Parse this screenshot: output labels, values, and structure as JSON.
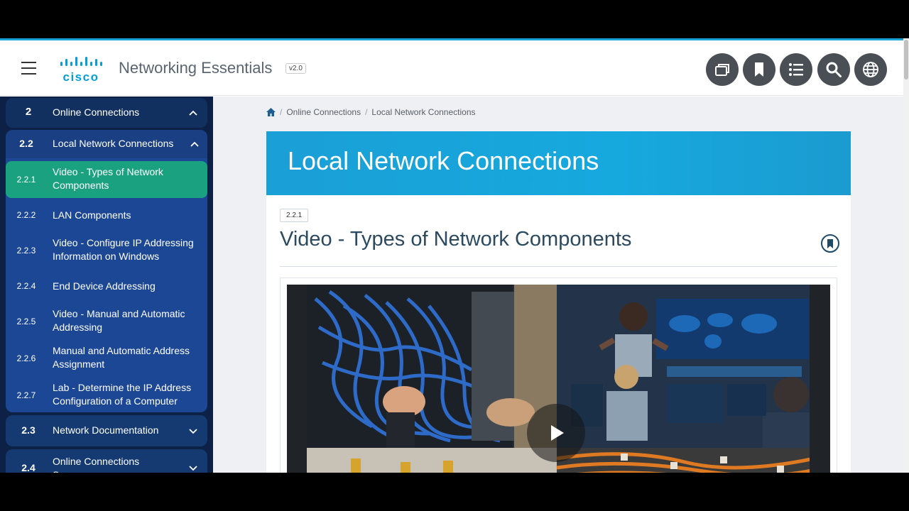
{
  "header": {
    "logo_text": "cisco",
    "title": "Networking Essentials",
    "version": "v2.0",
    "buttons": [
      {
        "icon": "window-icon"
      },
      {
        "icon": "bookmark-icon"
      },
      {
        "icon": "list-icon"
      },
      {
        "icon": "search-icon"
      },
      {
        "icon": "globe-icon"
      }
    ]
  },
  "sidebar": {
    "module": {
      "num": "2",
      "label": "Online Connections"
    },
    "section": {
      "num": "2.2",
      "label": "Local Network Connections"
    },
    "items": [
      {
        "num": "2.2.1",
        "label": "Video - Types of Network Components"
      },
      {
        "num": "2.2.2",
        "label": "LAN Components"
      },
      {
        "num": "2.2.3",
        "label": "Video - Configure IP Addressing Information on Windows"
      },
      {
        "num": "2.2.4",
        "label": "End Device Addressing"
      },
      {
        "num": "2.2.5",
        "label": "Video - Manual and Automatic Addressing"
      },
      {
        "num": "2.2.6",
        "label": "Manual and Automatic Address Assignment"
      },
      {
        "num": "2.2.7",
        "label": "Lab - Determine the IP Address Configuration of a Computer"
      }
    ],
    "next_sections": [
      {
        "num": "2.3",
        "label": "Network Documentation"
      },
      {
        "num": "2.4",
        "label": "Online Connections Summary"
      }
    ]
  },
  "breadcrumb": {
    "items": [
      "Online Connections",
      "Local Network Connections"
    ]
  },
  "banner": {
    "title": "Local Network Connections"
  },
  "topic": {
    "badge": "2.2.1",
    "title": "Video - Types of Network Components"
  },
  "colors": {
    "sidebar_bg": "#0d2146",
    "sidebar_module": "#153a72",
    "sidebar_group": "#1c4795",
    "active_item": "#1aa180",
    "banner": "#1aa3d8",
    "header_button": "#4a4f55"
  }
}
